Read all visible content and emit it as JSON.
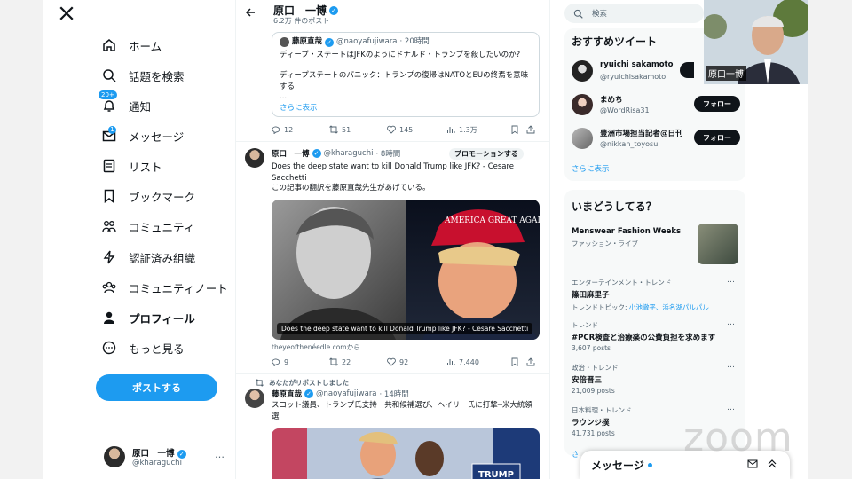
{
  "nav": {
    "items": [
      {
        "label": "ホーム",
        "icon": "home-icon"
      },
      {
        "label": "話題を検索",
        "icon": "search-icon"
      },
      {
        "label": "通知",
        "icon": "bell-icon",
        "badge": "20+"
      },
      {
        "label": "メッセージ",
        "icon": "mail-icon",
        "badge": "1"
      },
      {
        "label": "リスト",
        "icon": "list-icon"
      },
      {
        "label": "ブックマーク",
        "icon": "bookmark-icon"
      },
      {
        "label": "コミュニティ",
        "icon": "community-icon"
      },
      {
        "label": "認証済み組織",
        "icon": "lightning-icon"
      },
      {
        "label": "コミュニティノート",
        "icon": "notes-icon"
      },
      {
        "label": "プロフィール",
        "icon": "person-icon"
      },
      {
        "label": "もっと見る",
        "icon": "more-circle-icon"
      }
    ],
    "post_button": "ポストする",
    "me": {
      "name": "原口　一博",
      "handle": "@kharaguchi",
      "more": "…"
    }
  },
  "header": {
    "name": "原口　一博",
    "post_count": "6.2万 件のポスト"
  },
  "quote_tweet": {
    "author": "藤原直哉",
    "handle": "@naoyafujiwara",
    "time": "· 20時間",
    "line1": "ディープ・ステートはJFKのようにドナルド・トランプを殺したいのか?",
    "line2": "ディープステートのパニック：トランプの復帰はNATOとEUの終焉を意味する",
    "ellipsis": "...",
    "show_more": "さらに表示"
  },
  "actions_1": {
    "reply": "12",
    "repost": "51",
    "like": "145",
    "views": "1.3万"
  },
  "tweet_2": {
    "author": "原口　一博",
    "handle": "@kharaguchi",
    "time": "· 8時間",
    "promo": "プロモーションする",
    "text1": "Does the deep state want to kill Donald Trump like JFK? - Cesare Sacchetti",
    "text2": "この記事の翻訳を藤原直哉先生があげている。",
    "card_caption": "Does the deep state want to kill Donald Trump like JFK? - Cesare Sacchetti",
    "hat_text": "AMERICA GREAT AGAIN",
    "source": "theyeofthenéedle.comから"
  },
  "actions_2": {
    "reply": "9",
    "repost": "22",
    "like": "92",
    "views": "7,440"
  },
  "tweet_3": {
    "reposted_by": "あなたがリポストしました",
    "author": "藤原直哉",
    "handle": "@naoyafujiwara",
    "time": "· 14時間",
    "text": "スコット議員、トランプ氏支持　共和候補選び、ヘイリー氏に打撃─米大統領選",
    "sign_text": "TRUMP"
  },
  "search": {
    "placeholder": "検索"
  },
  "recommend": {
    "title": "おすすめツイート",
    "users": [
      {
        "name": "ryuichi sakamoto",
        "handle": "@ryuichisakamoto",
        "button": ""
      },
      {
        "name": "まめち",
        "handle": "@WordRisa31",
        "button": "フォロー"
      },
      {
        "name": "豊洲市場担当記者@日刊",
        "handle": "@nikkan_toyosu",
        "button": "フォロー"
      }
    ],
    "show_more": "さらに表示"
  },
  "trends": {
    "title": "いまどうしてる？",
    "featured": {
      "title": "Menswear Fashion Weeks",
      "category": "ファッション・ライブ"
    },
    "items": [
      {
        "category": "エンターテインメント・トレンド",
        "title": "篠田麻里子",
        "extra_prefix": "トレンドトピック: ",
        "extra_links": "小池徹平、浜名湖パルパル",
        "count": ""
      },
      {
        "category": "トレンド",
        "title": "#PCR検査と治療薬の公費負担を求めます",
        "count": "3,607 posts"
      },
      {
        "category": "政治・トレンド",
        "title": "安倍晋三",
        "count": "21,009 posts"
      },
      {
        "category": "日本料理・トレンド",
        "title": "ラウンジ撲",
        "count": "41,731 posts"
      }
    ],
    "more_dots": "…",
    "show_more": "さ"
  },
  "messages": {
    "label": "メッセージ"
  },
  "video": {
    "name": "原口一博"
  },
  "overlay": {
    "zoom": "zoom"
  }
}
